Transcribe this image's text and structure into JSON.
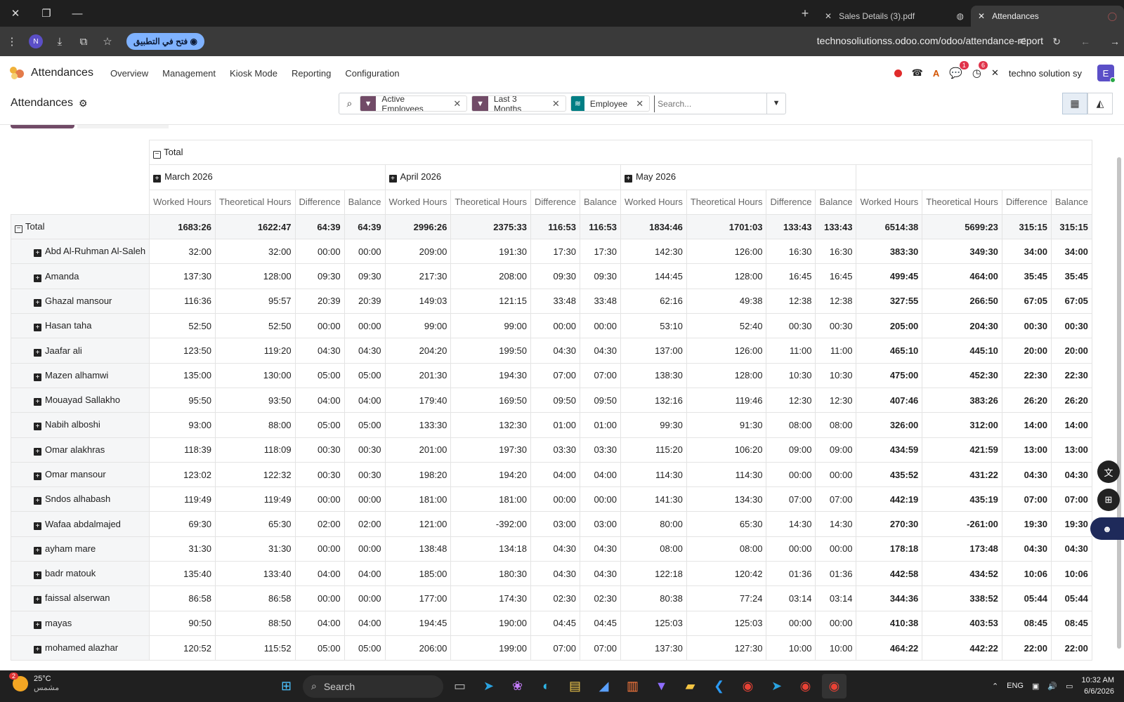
{
  "browser": {
    "tabs": [
      {
        "title": "Sales Details (3).pdf",
        "active": false
      },
      {
        "title": "Attendances",
        "active": true
      }
    ],
    "open_in_app": "فتح في التطبيق",
    "url": "technosoliutionss.odoo.com/odoo/attendance-report",
    "profile_initial": "N"
  },
  "app": {
    "name": "Attendances",
    "menu": [
      "Overview",
      "Management",
      "Kiosk Mode",
      "Reporting",
      "Configuration"
    ],
    "company": "techno solution sy",
    "user_initial": "E",
    "chat_badge": "1",
    "activity_badge": "6"
  },
  "control": {
    "title": "Attendances",
    "facets": [
      {
        "label": "Active Employees",
        "type": "filter",
        "color": "#714b67"
      },
      {
        "label": "Last 3 Months",
        "type": "filter",
        "color": "#714b67"
      },
      {
        "label": "Employee",
        "type": "groupby",
        "color": "#017e84"
      }
    ],
    "search_placeholder": "Search..."
  },
  "pivot": {
    "total_label": "Total",
    "months": [
      "March 2026",
      "April 2026",
      "May 2026"
    ],
    "measures": [
      "Worked Hours",
      "Theoretical Hours",
      "Difference",
      "Balance"
    ],
    "total_row": [
      "1683:26",
      "1622:47",
      "64:39",
      "64:39",
      "2996:26",
      "2375:33",
      "116:53",
      "116:53",
      "1834:46",
      "1701:03",
      "133:43",
      "133:43",
      "6514:38",
      "5699:23",
      "315:15",
      "315:15"
    ],
    "rows": [
      {
        "name": "Abd Al-Ruhman Al-Saleh",
        "v": [
          "32:00",
          "32:00",
          "00:00",
          "00:00",
          "209:00",
          "191:30",
          "17:30",
          "17:30",
          "142:30",
          "126:00",
          "16:30",
          "16:30",
          "383:30",
          "349:30",
          "34:00",
          "34:00"
        ]
      },
      {
        "name": "Amanda",
        "v": [
          "137:30",
          "128:00",
          "09:30",
          "09:30",
          "217:30",
          "208:00",
          "09:30",
          "09:30",
          "144:45",
          "128:00",
          "16:45",
          "16:45",
          "499:45",
          "464:00",
          "35:45",
          "35:45"
        ]
      },
      {
        "name": "Ghazal mansour",
        "v": [
          "116:36",
          "95:57",
          "20:39",
          "20:39",
          "149:03",
          "121:15",
          "33:48",
          "33:48",
          "62:16",
          "49:38",
          "12:38",
          "12:38",
          "327:55",
          "266:50",
          "67:05",
          "67:05"
        ]
      },
      {
        "name": "Hasan taha",
        "v": [
          "52:50",
          "52:50",
          "00:00",
          "00:00",
          "99:00",
          "99:00",
          "00:00",
          "00:00",
          "53:10",
          "52:40",
          "00:30",
          "00:30",
          "205:00",
          "204:30",
          "00:30",
          "00:30"
        ]
      },
      {
        "name": "Jaafar ali",
        "v": [
          "123:50",
          "119:20",
          "04:30",
          "04:30",
          "204:20",
          "199:50",
          "04:30",
          "04:30",
          "137:00",
          "126:00",
          "11:00",
          "11:00",
          "465:10",
          "445:10",
          "20:00",
          "20:00"
        ]
      },
      {
        "name": "Mazen alhamwi",
        "v": [
          "135:00",
          "130:00",
          "05:00",
          "05:00",
          "201:30",
          "194:30",
          "07:00",
          "07:00",
          "138:30",
          "128:00",
          "10:30",
          "10:30",
          "475:00",
          "452:30",
          "22:30",
          "22:30"
        ]
      },
      {
        "name": "Mouayad Sallakho",
        "v": [
          "95:50",
          "93:50",
          "04:00",
          "04:00",
          "179:40",
          "169:50",
          "09:50",
          "09:50",
          "132:16",
          "119:46",
          "12:30",
          "12:30",
          "407:46",
          "383:26",
          "26:20",
          "26:20"
        ]
      },
      {
        "name": "Nabih alboshi",
        "v": [
          "93:00",
          "88:00",
          "05:00",
          "05:00",
          "133:30",
          "132:30",
          "01:00",
          "01:00",
          "99:30",
          "91:30",
          "08:00",
          "08:00",
          "326:00",
          "312:00",
          "14:00",
          "14:00"
        ]
      },
      {
        "name": "Omar alakhras",
        "v": [
          "118:39",
          "118:09",
          "00:30",
          "00:30",
          "201:00",
          "197:30",
          "03:30",
          "03:30",
          "115:20",
          "106:20",
          "09:00",
          "09:00",
          "434:59",
          "421:59",
          "13:00",
          "13:00"
        ]
      },
      {
        "name": "Omar mansour",
        "v": [
          "123:02",
          "122:32",
          "00:30",
          "00:30",
          "198:20",
          "194:20",
          "04:00",
          "04:00",
          "114:30",
          "114:30",
          "00:00",
          "00:00",
          "435:52",
          "431:22",
          "04:30",
          "04:30"
        ]
      },
      {
        "name": "Sndos alhabash",
        "v": [
          "119:49",
          "119:49",
          "00:00",
          "00:00",
          "181:00",
          "181:00",
          "00:00",
          "00:00",
          "141:30",
          "134:30",
          "07:00",
          "07:00",
          "442:19",
          "435:19",
          "07:00",
          "07:00"
        ]
      },
      {
        "name": "Wafaa abdalmajed",
        "v": [
          "69:30",
          "65:30",
          "02:00",
          "02:00",
          "121:00",
          "-392:00",
          "03:00",
          "03:00",
          "80:00",
          "65:30",
          "14:30",
          "14:30",
          "270:30",
          "-261:00",
          "19:30",
          "19:30"
        ]
      },
      {
        "name": "ayham mare",
        "v": [
          "31:30",
          "31:30",
          "00:00",
          "00:00",
          "138:48",
          "134:18",
          "04:30",
          "04:30",
          "08:00",
          "08:00",
          "00:00",
          "00:00",
          "178:18",
          "173:48",
          "04:30",
          "04:30"
        ]
      },
      {
        "name": "badr matouk",
        "v": [
          "135:40",
          "133:40",
          "04:00",
          "04:00",
          "185:00",
          "180:30",
          "04:30",
          "04:30",
          "122:18",
          "120:42",
          "01:36",
          "01:36",
          "442:58",
          "434:52",
          "10:06",
          "10:06"
        ]
      },
      {
        "name": "faissal alserwan",
        "v": [
          "86:58",
          "86:58",
          "00:00",
          "00:00",
          "177:00",
          "174:30",
          "02:30",
          "02:30",
          "80:38",
          "77:24",
          "03:14",
          "03:14",
          "344:36",
          "338:52",
          "05:44",
          "05:44"
        ]
      },
      {
        "name": "mayas",
        "v": [
          "90:50",
          "88:50",
          "04:00",
          "04:00",
          "194:45",
          "190:00",
          "04:45",
          "04:45",
          "125:03",
          "125:03",
          "00:00",
          "00:00",
          "410:38",
          "403:53",
          "08:45",
          "08:45"
        ]
      },
      {
        "name": "mohamed alazhar",
        "v": [
          "120:52",
          "115:52",
          "05:00",
          "05:00",
          "206:00",
          "199:00",
          "07:00",
          "07:00",
          "137:30",
          "127:30",
          "10:00",
          "10:00",
          "464:22",
          "442:22",
          "22:00",
          "22:00"
        ]
      }
    ]
  },
  "taskbar": {
    "weather_temp": "25°C",
    "weather_label": "مشمس",
    "weather_badge": "2",
    "search_label": "Search",
    "lang": "ENG",
    "time": "10:32 AM",
    "date": "6/6/2026"
  }
}
